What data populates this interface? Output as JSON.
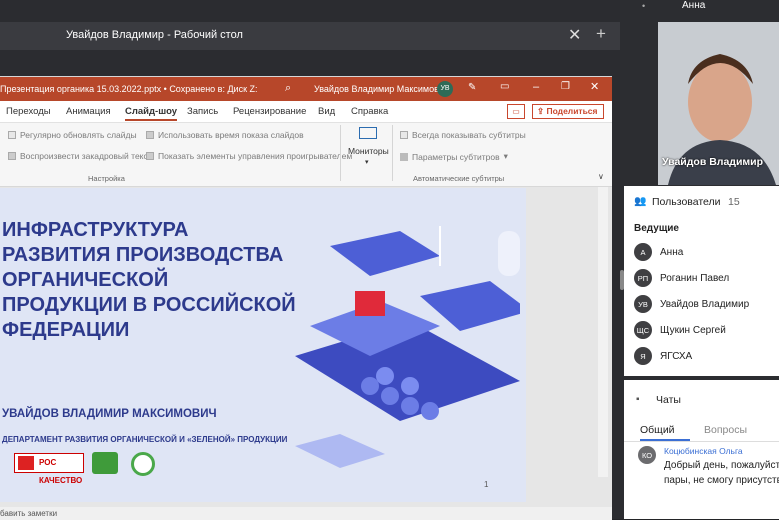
{
  "window": {
    "title": "Увайдов Владимир - Рабочий стол",
    "close_icon": "close-icon",
    "plus_icon": "plus-icon"
  },
  "ppt": {
    "filename": "Презентация органика 15.03.2022.pptx • Сохранено в: Диск Z:",
    "user": "Увайдов Владимир Максимович",
    "user_initials": "УВ",
    "tabs": [
      "Переходы",
      "Анимация",
      "Слайд-шоу",
      "Запись",
      "Рецензирование",
      "Вид",
      "Справка"
    ],
    "active_tab": "Слайд-шоу",
    "share_label": "Поделиться",
    "ribbon": {
      "opt1": "Регулярно обновлять слайды",
      "opt2": "Использовать время показа слайдов",
      "opt3": "Воспроизвести закадровый текст",
      "opt4": "Показать элементы управления проигрывателем",
      "group1": "Настройка",
      "monitors": "Мониторы",
      "opt5": "Всегда показывать субтитры",
      "opt6": "Параметры субтитров",
      "group2": "Автоматические субтитры"
    },
    "slide": {
      "title": [
        "ИНФРАСТРУКТУРА",
        "РАЗВИТИЯ ПРОИЗВОДСТВА",
        "ОРГАНИЧЕСКОЙ",
        "ПРОДУКЦИИ В РОССИЙСКОЙ",
        "ФЕДЕРАЦИИ"
      ],
      "author": "УВАЙДОВ ВЛАДИМИР МАКСИМОВИЧ",
      "dept": "ДЕПАРТАМЕНТ РАЗВИТИЯ ОРГАНИЧЕСКОЙ И «ЗЕЛЕНОЙ» ПРОДУКЦИИ",
      "logo1": "РОС КАЧЕСТВО",
      "page": "1"
    },
    "notes": "бавить заметки"
  },
  "panel": {
    "cam_top_label": "Анна",
    "cam_name": "Увайдов Владимир",
    "users_title": "Пользователи",
    "users_count": "15",
    "hosts_title": "Ведущие",
    "users": [
      {
        "initials": "А",
        "name": "Анна"
      },
      {
        "initials": "РП",
        "name": "Роганин Павел"
      },
      {
        "initials": "УВ",
        "name": "Увайдов Владимир"
      },
      {
        "initials": "ЩС",
        "name": "Щукин Сергей"
      },
      {
        "initials": "Я",
        "name": "ЯГСХА"
      }
    ],
    "chats_title": "Чаты",
    "chat_tabs": [
      "Общий",
      "Вопросы"
    ],
    "message": {
      "initials": "КО",
      "author": "Коцюбинская Ольга",
      "text1": "Добрый день, пожалуйст",
      "text2": "пары, не смогу присутств"
    }
  }
}
